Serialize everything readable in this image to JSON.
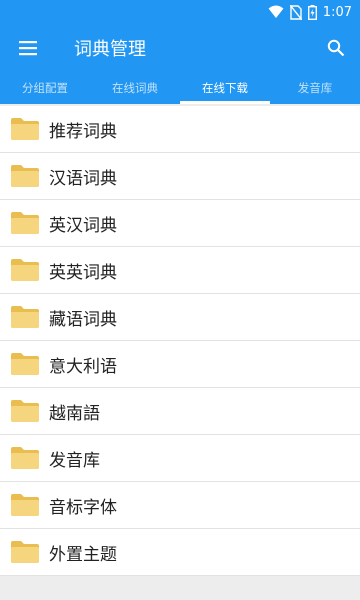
{
  "status_bar": {
    "time": "1:07",
    "icons": [
      "wifi-icon",
      "no-sim-icon",
      "battery-icon"
    ]
  },
  "app_bar": {
    "title": "词典管理",
    "menu_icon": "hamburger-menu-icon",
    "search_icon": "search-icon"
  },
  "tabs": [
    {
      "label": "分组配置",
      "active": false
    },
    {
      "label": "在线词典",
      "active": false
    },
    {
      "label": "在线下载",
      "active": true
    },
    {
      "label": "发音库",
      "active": false
    }
  ],
  "list": {
    "icon": "folder-icon",
    "items": [
      {
        "label": "推荐词典"
      },
      {
        "label": "汉语词典"
      },
      {
        "label": "英汉词典"
      },
      {
        "label": "英英词典"
      },
      {
        "label": "藏语词典"
      },
      {
        "label": "意大利语"
      },
      {
        "label": "越南語"
      },
      {
        "label": "发音库"
      },
      {
        "label": "音标字体"
      },
      {
        "label": "外置主题"
      }
    ]
  },
  "colors": {
    "primary": "#2196f3",
    "folder": "#f2cf73",
    "background": "#ededed"
  }
}
